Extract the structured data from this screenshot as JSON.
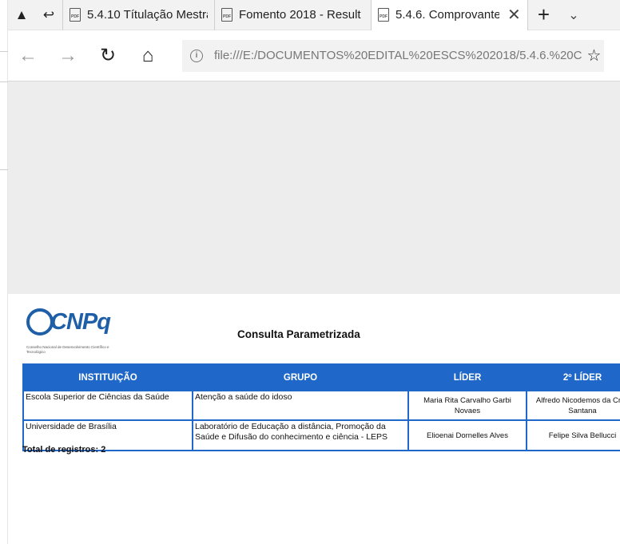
{
  "browser": {
    "tabs": [
      {
        "label": "5.4.10 Títulação Mestra",
        "active": false
      },
      {
        "label": "Fomento 2018 - Result",
        "active": false
      },
      {
        "label": "5.4.6. Comprovante",
        "active": true
      }
    ],
    "new_tab_label": "+",
    "address": "file:///E:/DOCUMENTOS%20EDITAL%20ESCS%202018/5.4.6.%20C"
  },
  "report": {
    "logo_text": "CNPq",
    "logo_sub": "Conselho Nacional de Desenvolvimento Científico e Tecnológico",
    "title": "Consulta Parametrizada",
    "columns": [
      "INSTITUIÇÃO",
      "GRUPO",
      "LÍDER",
      "2º LÍDER"
    ],
    "rows": [
      {
        "instituicao": "Escola Superior de Ciências da Saúde",
        "grupo": "Atenção a saúde do idoso",
        "lider": "Maria Rita Carvalho Garbi Novaes",
        "lider2": "Alfredo Nicodemos da Cruz Santana"
      },
      {
        "instituicao": "Universidade de Brasília",
        "grupo": "Laboratório de Educação a distância, Promoção da Saúde e Difusão do conhecimento e ciência - LEPS",
        "lider": "Elioenai Dornelles Alves",
        "lider2": "Felipe Silva Bellucci"
      }
    ],
    "total": "Total de registros: 2"
  },
  "colors": {
    "accent": "#1f68c9",
    "logo": "#1f5fa8"
  },
  "icons": [
    "tab-actions-icon",
    "back-tabs-icon",
    "pdf-icon",
    "close-icon",
    "back-icon",
    "forward-icon",
    "refresh-icon",
    "home-icon",
    "info-icon",
    "favorite-star-icon",
    "chevron-down-icon"
  ]
}
